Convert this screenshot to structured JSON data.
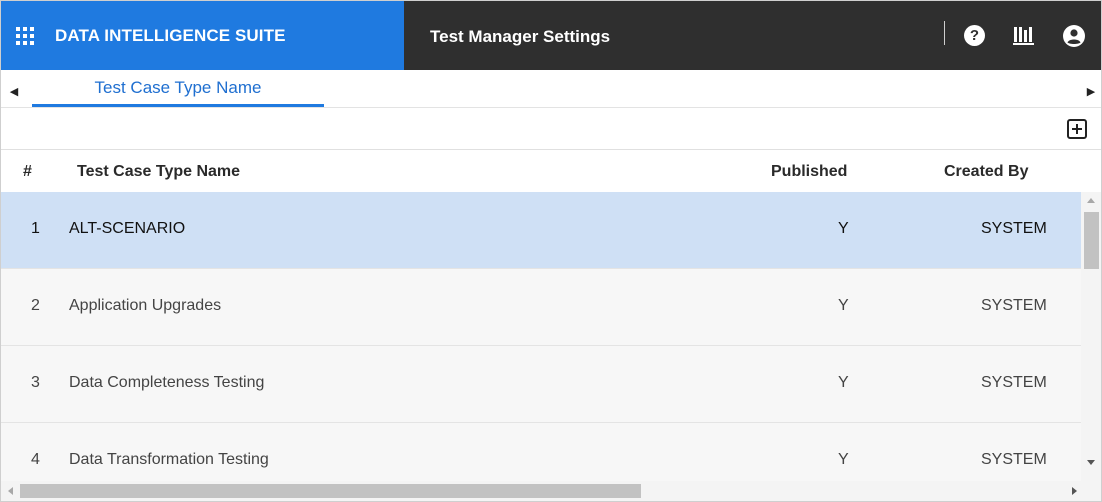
{
  "header": {
    "brand_title": "DATA INTELLIGENCE SUITE",
    "page_title": "Test Manager Settings",
    "brand_color": "#1f7ae0",
    "bar_color": "#2f2f2f",
    "icons": [
      "apps-grid-icon",
      "help-icon",
      "library-icon",
      "user-icon"
    ],
    "help_glyph": "?"
  },
  "tabs": {
    "items": [
      {
        "label": "Test Case Type Name",
        "active": true
      }
    ],
    "scroll_left_glyph": "◀",
    "scroll_right_glyph": "▶"
  },
  "toolbar": {
    "icons": [
      "add-icon"
    ]
  },
  "table": {
    "columns": {
      "num": "#",
      "name": "Test Case Type Name",
      "published": "Published",
      "created_by": "Created By"
    },
    "rows": [
      {
        "num": "1",
        "name": "ALT-SCENARIO",
        "published": "Y",
        "created_by": "SYSTEM",
        "selected": true
      },
      {
        "num": "2",
        "name": "Application Upgrades",
        "published": "Y",
        "created_by": "SYSTEM",
        "selected": false
      },
      {
        "num": "3",
        "name": "Data Completeness Testing",
        "published": "Y",
        "created_by": "SYSTEM",
        "selected": false
      },
      {
        "num": "4",
        "name": "Data Transformation Testing",
        "published": "Y",
        "created_by": "SYSTEM",
        "selected": false
      }
    ],
    "selected_row_color": "#cfe0f5"
  }
}
